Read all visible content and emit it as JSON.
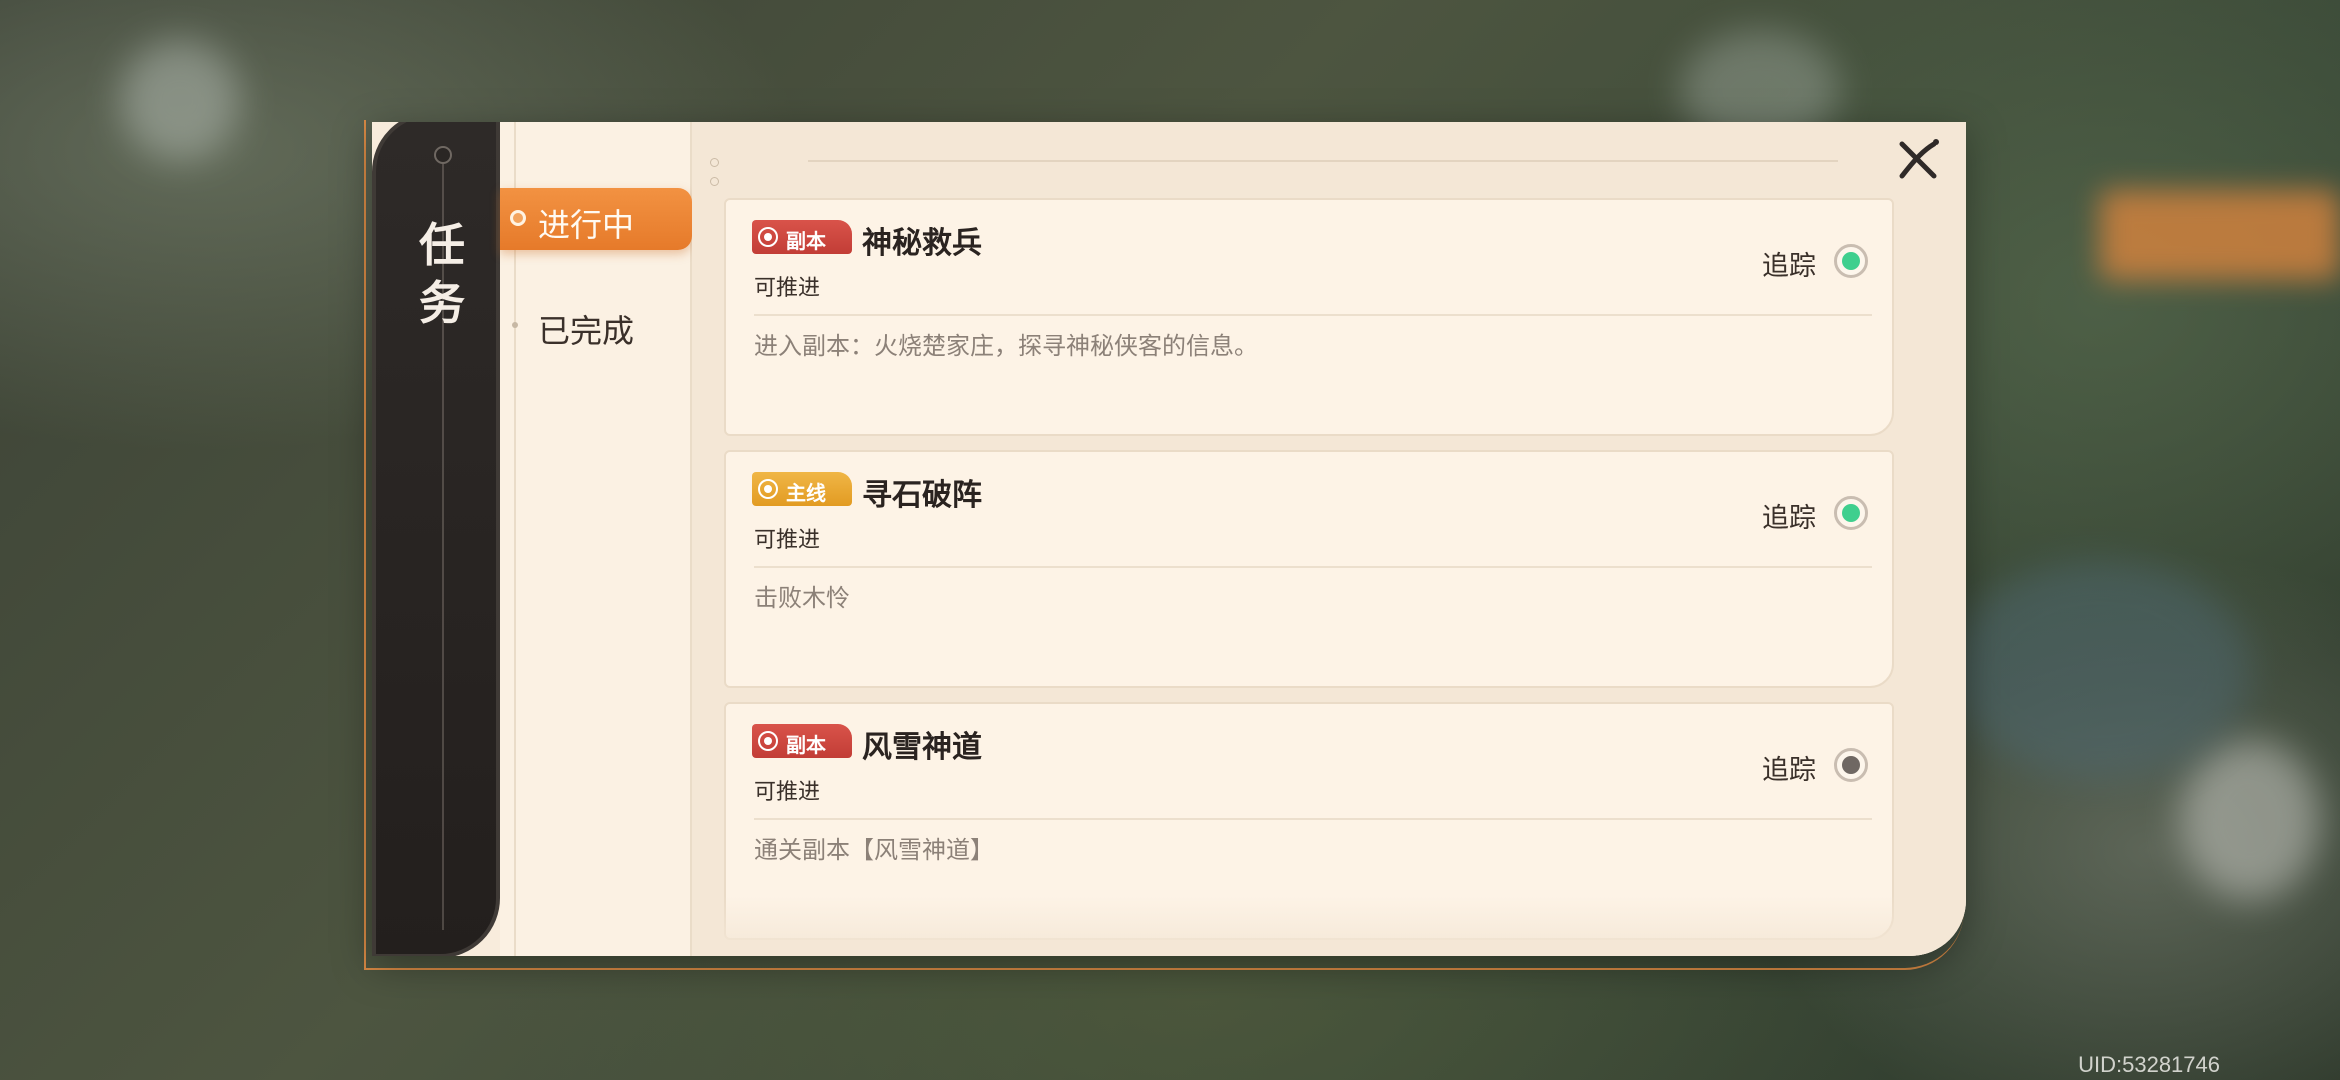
{
  "uid": "UID:53281746",
  "panel": {
    "title": "任\n务"
  },
  "tabs": [
    {
      "label": "进行中",
      "active": true
    },
    {
      "label": "已完成",
      "active": false
    }
  ],
  "quests": [
    {
      "badge": "副本",
      "badge_color": "#c8413a",
      "title": "神秘救兵",
      "status": "可推进",
      "track_label": "追踪",
      "tracked": true,
      "track_color": "#3fcf8e",
      "description": "进入副本：火烧楚家庄，探寻神秘侠客的信息。"
    },
    {
      "badge": "主线",
      "badge_color": "#e9a630",
      "title": "寻石破阵",
      "status": "可推进",
      "track_label": "追踪",
      "tracked": true,
      "track_color": "#3fcf8e",
      "description": "击败木怜"
    },
    {
      "badge": "副本",
      "badge_color": "#c8413a",
      "title": "风雪神道",
      "status": "可推进",
      "track_label": "追踪",
      "tracked": false,
      "track_color": "#6f6863",
      "description": "通关副本【风雪神道】"
    }
  ],
  "icons": {
    "close": "close-crossed-swords-icon",
    "badge": "target-ring-icon"
  }
}
